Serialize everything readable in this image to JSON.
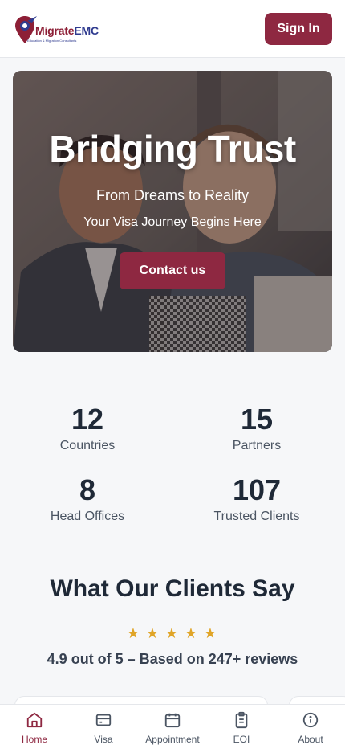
{
  "header": {
    "logo_text_part1": "Migrate",
    "logo_text_part2": "EMC",
    "logo_tagline": "Education & Migration Consultants",
    "signin_label": "Sign In"
  },
  "hero": {
    "title": "Bridging Trust",
    "subtitle": "From Dreams to Reality",
    "tagline": "Your Visa Journey Begins Here",
    "cta_label": "Contact us"
  },
  "stats": [
    {
      "value": "12",
      "label": "Countries"
    },
    {
      "value": "15",
      "label": "Partners"
    },
    {
      "value": "8",
      "label": "Head Offices"
    },
    {
      "value": "107",
      "label": "Trusted Clients"
    }
  ],
  "testimonials": {
    "title": "What Our Clients Say",
    "stars": 5,
    "rating_text": "4.9 out of 5 – Based on 247+ reviews"
  },
  "nav": {
    "items": [
      {
        "label": "Home",
        "icon": "home-icon",
        "active": true
      },
      {
        "label": "Visa",
        "icon": "card-icon",
        "active": false
      },
      {
        "label": "Appointment",
        "icon": "calendar-icon",
        "active": false
      },
      {
        "label": "EOI",
        "icon": "clipboard-icon",
        "active": false
      },
      {
        "label": "About",
        "icon": "info-icon",
        "active": false
      }
    ]
  },
  "colors": {
    "brand": "#8e2841",
    "brand_blue": "#2f3b8f",
    "star": "#e0a528",
    "text_dark": "#1f2937"
  }
}
